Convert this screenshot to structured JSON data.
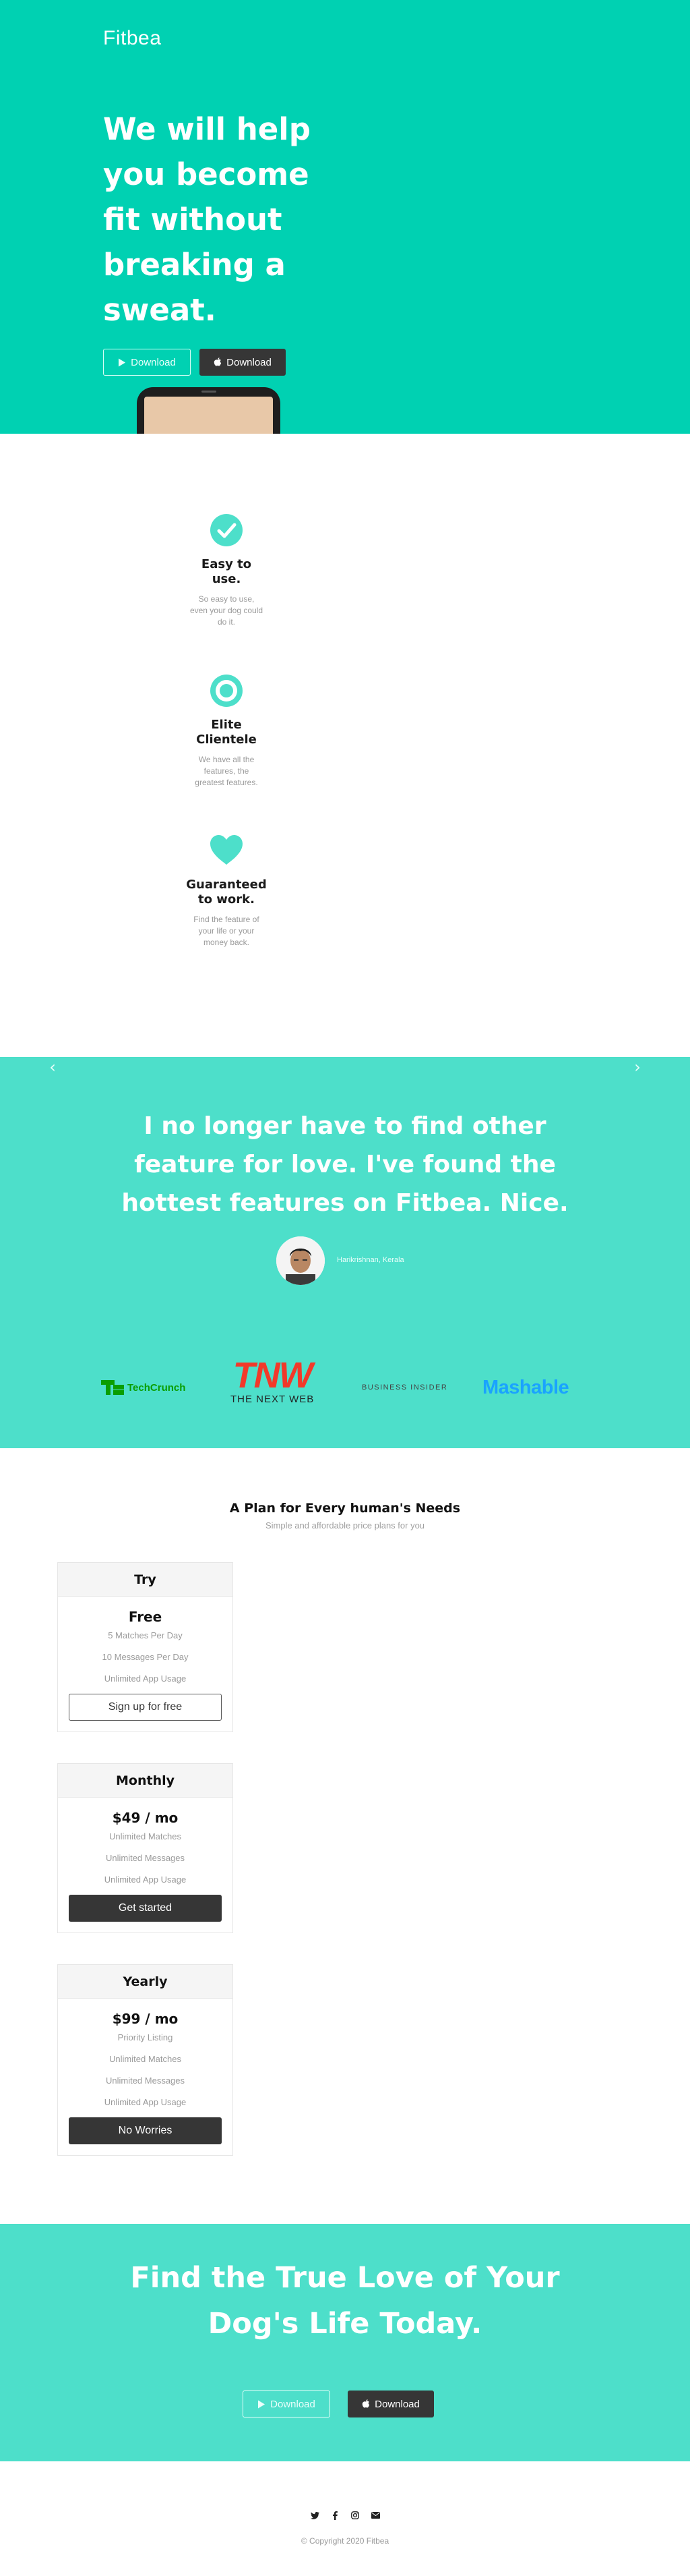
{
  "header": {
    "logo": "Fitbea"
  },
  "hero": {
    "title": "We will help you become fit without breaking a sweat.",
    "android_button": "Download",
    "ios_button": "Download",
    "background_color": "#00d1b2"
  },
  "features": [
    {
      "icon": "check-circle-icon",
      "title": "Easy to use.",
      "description": "So easy to use, even your dog could do it."
    },
    {
      "icon": "bullseye-icon",
      "title": "Elite Clientele",
      "description": "We have all the features, the greatest features."
    },
    {
      "icon": "heart-icon",
      "title": "Guaranteed to work.",
      "description": "Find the feature of your life or your money back."
    }
  ],
  "testimonial": {
    "quote": "I no longer have to find other feature for love. I've found the hottest features on Fitbea. Nice.",
    "author": "Harikrishnan, Kerala",
    "prev_icon": "chevron-left-icon",
    "next_icon": "chevron-right-icon",
    "background_color": "#4ddfca"
  },
  "press": {
    "techcrunch": "TechCrunch",
    "tnw": "TNW",
    "tnw_sub": "THE NEXT WEB",
    "business_insider": "BUSINESS INSIDER",
    "mashable": "Mashable"
  },
  "pricing": {
    "title": "A Plan for Every human's Needs",
    "subtitle": "Simple and affordable price plans for you",
    "plans": [
      {
        "name": "Try",
        "price": "Free",
        "features": [
          "5 Matches Per Day",
          "10 Messages Per Day",
          "Unlimited App Usage"
        ],
        "button": "Sign up for free"
      },
      {
        "name": "Monthly",
        "price": "$49 / mo",
        "features": [
          "Unlimited Matches",
          "Unlimited Messages",
          "Unlimited App Usage"
        ],
        "button": "Get started"
      },
      {
        "name": "Yearly",
        "price": "$99 / mo",
        "features": [
          "Priority Listing",
          "Unlimited Matches",
          "Unlimited Messages",
          "Unlimited App Usage"
        ],
        "button": "No Worries"
      }
    ]
  },
  "cta": {
    "title": "Find the True Love of Your Dog's Life Today.",
    "android_button": "Download",
    "ios_button": "Download"
  },
  "footer": {
    "social": [
      "twitter-icon",
      "facebook-icon",
      "instagram-icon",
      "email-icon"
    ],
    "copyright": "© Copyright 2020 Fitbea"
  }
}
